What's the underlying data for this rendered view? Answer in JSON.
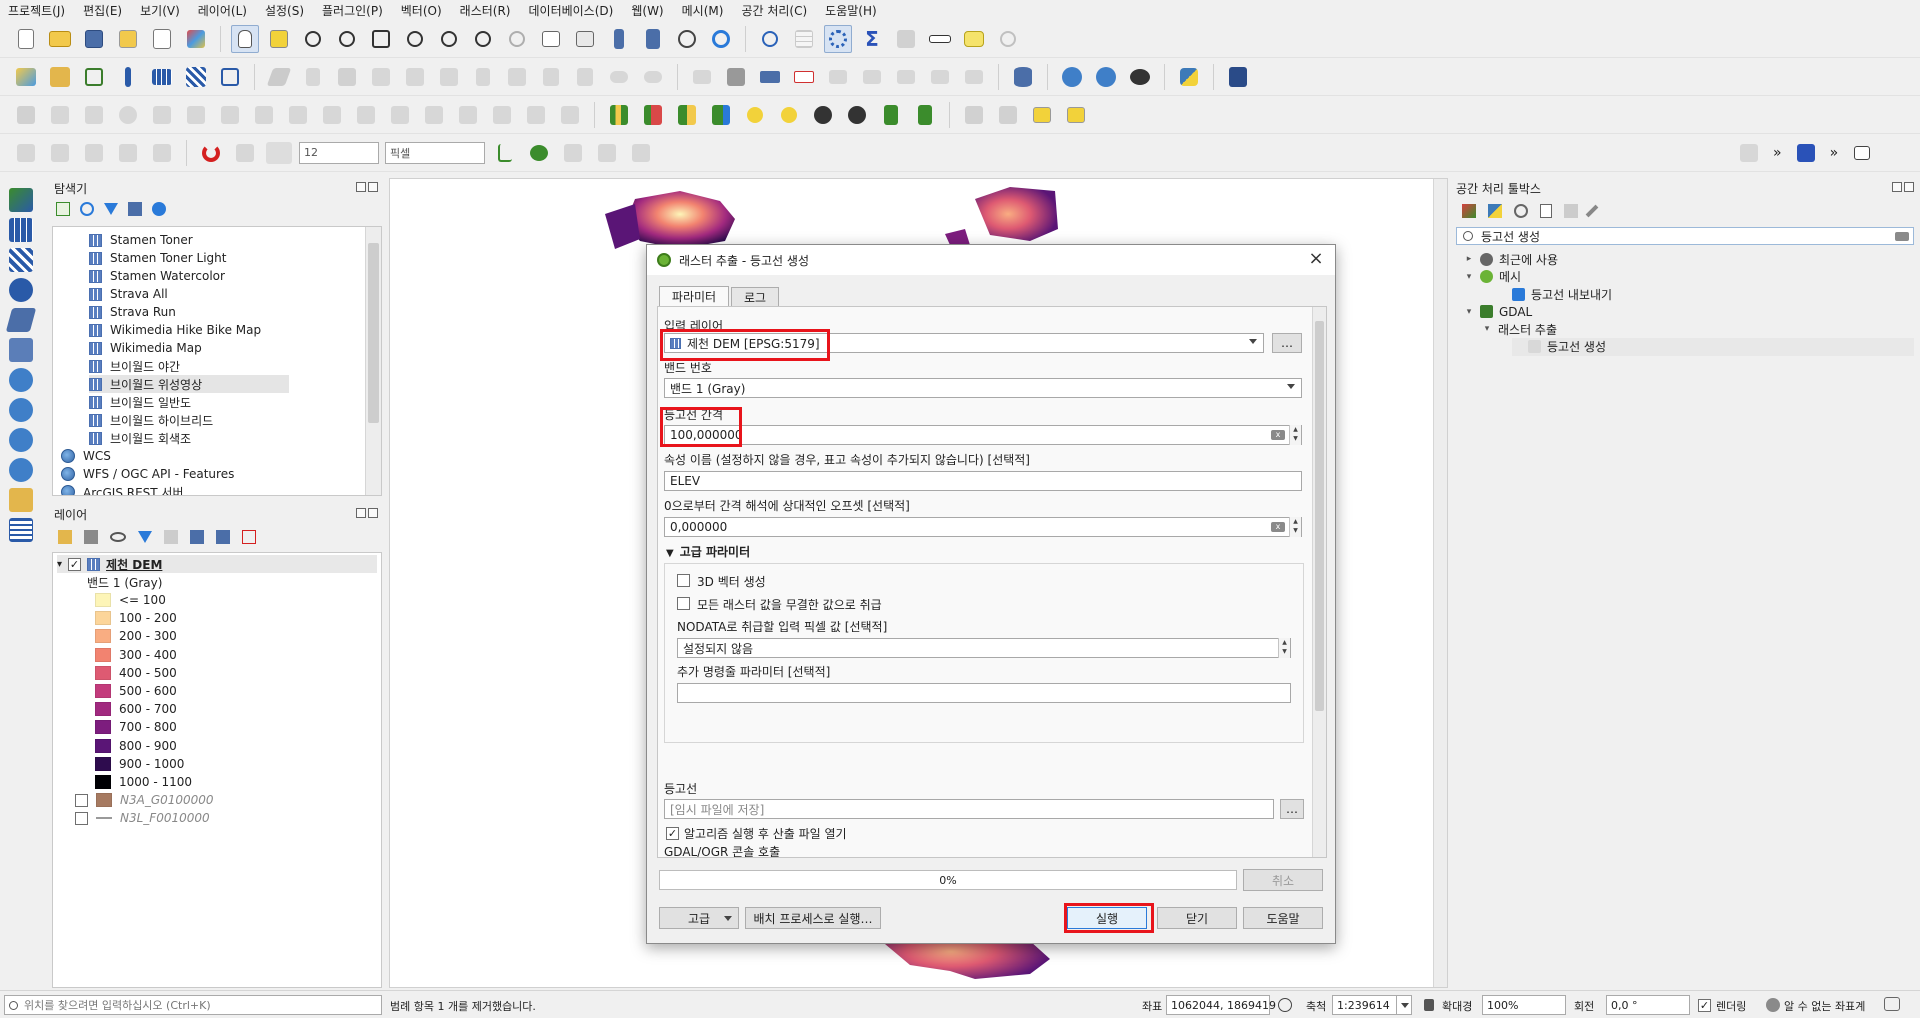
{
  "menu": [
    "프로젝트(J)",
    "편집(E)",
    "보기(V)",
    "레이어(L)",
    "설정(S)",
    "플러그인(P)",
    "벡터(O)",
    "래스터(R)",
    "데이터베이스(D)",
    "웹(W)",
    "메시(M)",
    "공간 처리(C)",
    "도움말(H)"
  ],
  "snapping": {
    "tolerance": "12",
    "unit": "픽셀"
  },
  "browser": {
    "title": "탐색기",
    "items": [
      "Stamen Toner",
      "Stamen Toner Light",
      "Stamen Watercolor",
      "Strava All",
      "Strava Run",
      "Wikimedia Hike Bike Map",
      "Wikimedia Map",
      "브이월드 야간",
      "브이월드 위성영상",
      "브이월드 일반도",
      "브이월드 하이브리드",
      "브이월드 회색조"
    ],
    "services": [
      "WCS",
      "WFS / OGC API - Features",
      "ArcGIS REST 서버"
    ]
  },
  "layers": {
    "title": "레이어",
    "dem_name": "제천 DEM",
    "band_label": "밴드 1 (Gray)",
    "legend": [
      {
        "label": "<= 100",
        "color": "#fdf5b8"
      },
      {
        "label": "100 - 200",
        "color": "#fcd59a"
      },
      {
        "label": "200 - 300",
        "color": "#f9ad82"
      },
      {
        "label": "300 - 400",
        "color": "#f28370"
      },
      {
        "label": "400 - 500",
        "color": "#de5a72"
      },
      {
        "label": "500 - 600",
        "color": "#c33b7c"
      },
      {
        "label": "600 - 700",
        "color": "#a1297f"
      },
      {
        "label": "700 - 800",
        "color": "#7d1d7e"
      },
      {
        "label": "800 - 900",
        "color": "#5a1576"
      },
      {
        "label": "900 - 1000",
        "color": "#2e0c4e"
      },
      {
        "label": "1000 - 1100",
        "color": "#000004"
      }
    ],
    "extra": [
      {
        "label": "N3A_G0100000",
        "color": "#a67a61"
      },
      {
        "label": "N3L_F0010000",
        "color": "#9a9a9a"
      }
    ]
  },
  "toolbox": {
    "title": "공간 처리 툴박스",
    "search": "등고선 생성",
    "tree": [
      {
        "label": "최근에 사용",
        "arrow": "▸"
      },
      {
        "label": "메시",
        "arrow": "▾"
      },
      {
        "label": "등고선 내보내기",
        "arrow": ""
      },
      {
        "label": "GDAL",
        "arrow": "▾"
      },
      {
        "label": "래스터 추출",
        "arrow": "▾"
      },
      {
        "label": "등고선 생성",
        "arrow": ""
      }
    ]
  },
  "dialog": {
    "title": "래스터 추출 - 등고선 생성",
    "tabs": [
      "파라미터",
      "로그"
    ],
    "input_layer_label": "입력 레이어",
    "input_layer_value": "제천 DEM [EPSG:5179]",
    "band_label": "밴드 번호",
    "band_value": "밴드 1 (Gray)",
    "interval_label": "등고선 간격",
    "interval_value": "100,000000",
    "attr_label": "속성 이름 (설정하지 않을 경우, 표고 속성이 추가되지 않습니다) [선택적]",
    "attr_value": "ELEV",
    "offset_label": "0으로부터 간격 해석에 상대적인 오프셋 [선택적]",
    "offset_value": "0,000000",
    "advanced_label": "고급 파라미터",
    "cb_3d": "3D 벡터 생성",
    "cb_nodata": "모든 래스터 값을 무결한 값으로 취급",
    "nodata_label": "NODATA로 취급할 입력 픽셀 값 [선택적]",
    "nodata_value": "설정되지 않음",
    "extra_label": "추가 명령줄 파라미터 [선택적]",
    "extra_value": "",
    "output_label": "등고선",
    "output_placeholder": "[임시 파일에 저장]",
    "open_after": "알고리즘 실행 후 산출 파일 열기",
    "console_label": "GDAL/OGR 콘솔 호출",
    "progress": "0%",
    "progress_value": 0,
    "cancel": "취소",
    "advanced_btn": "고급",
    "batch_btn": "배치 프로세스로 실행…",
    "run": "실행",
    "close": "닫기",
    "help": "도움말",
    "more": "…"
  },
  "status": {
    "search_placeholder": "위치를 찾으려면 입력하십시오 (Ctrl+K)",
    "message": "범례 항목 1 개를 제거했습니다.",
    "coord_label": "좌표",
    "coord_value": "1062044, 1869419",
    "scale_label": "축척",
    "scale_value": "1:239614",
    "mag_label": "확대경",
    "mag_value": "100%",
    "rot_label": "회전",
    "rot_value": "0,0 °",
    "render_label": "렌더링",
    "crs_label": "알 수 없는 좌표계"
  }
}
